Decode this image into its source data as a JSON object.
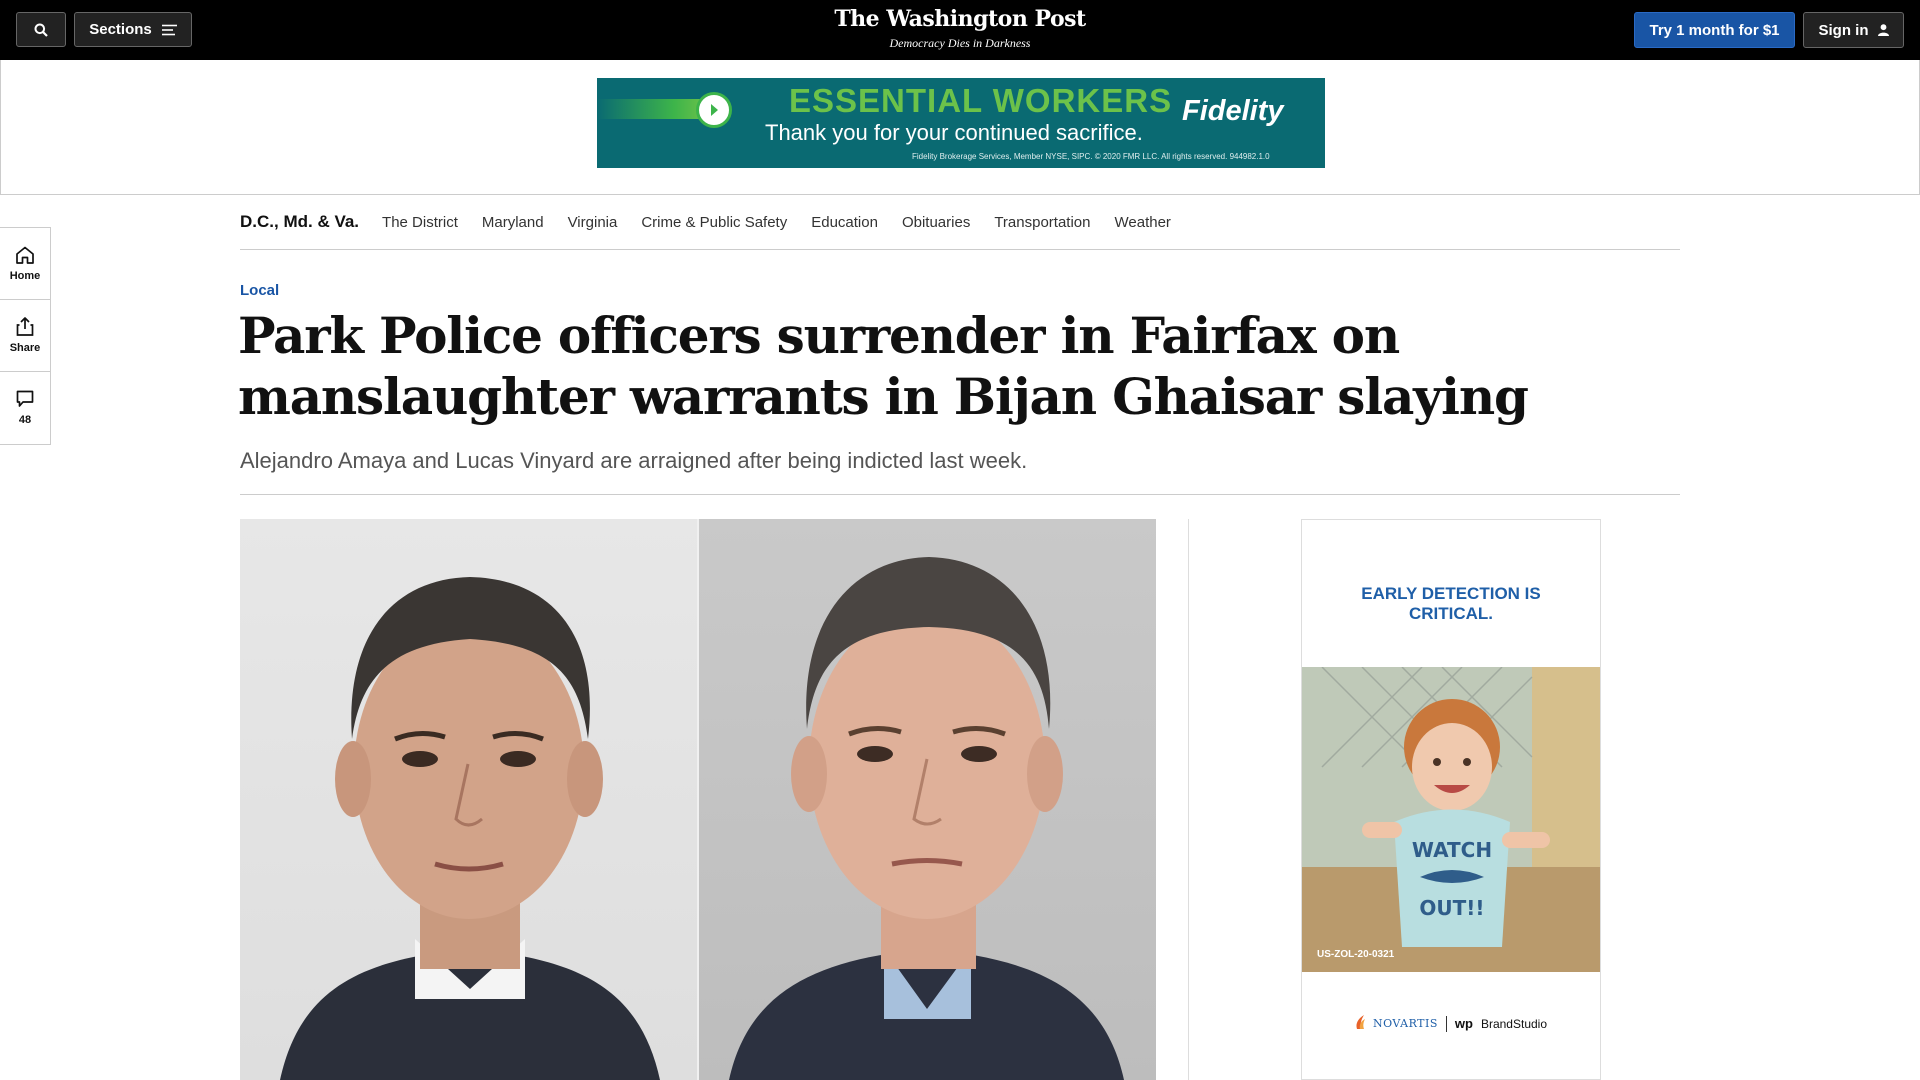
{
  "header": {
    "sections_label": "Sections",
    "logo": "The Washington Post",
    "tagline": "Democracy Dies in Darkness",
    "subscribe_label": "Try 1 month for $1",
    "signin_label": "Sign in"
  },
  "top_ad": {
    "headline": "ESSENTIAL WORKERS",
    "subline": "Thank you for your continued sacrifice.",
    "brand": "Fidelity",
    "fine_print": "Fidelity Brokerage Services, Member NYSE, SIPC. © 2020 FMR LLC. All rights reserved. 944982.1.0"
  },
  "section_nav": {
    "title": "D.C., Md. & Va.",
    "links": [
      "The District",
      "Maryland",
      "Virginia",
      "Crime & Public Safety",
      "Education",
      "Obituaries",
      "Transportation",
      "Weather"
    ]
  },
  "left_rail": {
    "home_label": "Home",
    "share_label": "Share",
    "comments_count": "48"
  },
  "article": {
    "kicker": "Local",
    "headline": "Park Police officers surrender in Fairfax on manslaughter warrants in Bijan Ghaisar slaying",
    "dek": "Alejandro Amaya and Lucas Vinyard are arraigned after being indicted last week."
  },
  "side_ad": {
    "headline_line1": "EARLY DETECTION IS",
    "headline_line2": "CRITICAL.",
    "shirt_text_1": "WATCH",
    "shirt_text_2": "OUT!!",
    "code": "US-ZOL-20-0321",
    "sponsor": "NOVARTIS",
    "studio_mark": "wp",
    "studio_name": "BrandStudio"
  },
  "colors": {
    "top_bar": "#000000",
    "accent_blue": "#1955a5",
    "ad_teal": "#0a6a72",
    "ad_green": "#6cc24a"
  }
}
